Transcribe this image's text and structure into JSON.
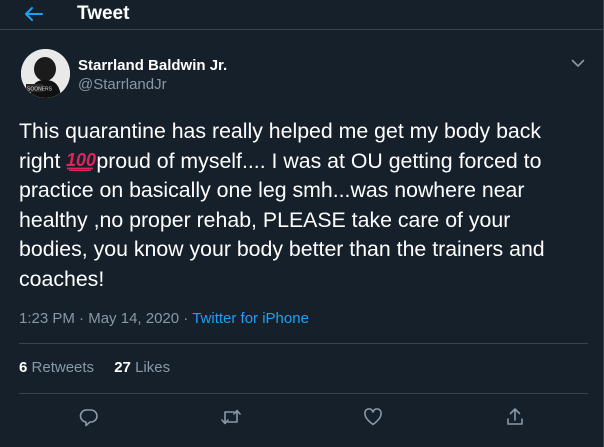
{
  "header": {
    "title": "Tweet",
    "back_icon": "arrow-left-icon"
  },
  "author": {
    "name": "Starrland Baldwin Jr.",
    "handle": "@StarrlandJr",
    "avatar_badge_text": "SOONERS"
  },
  "tweet": {
    "lines": [
      "This quarantine has really helped me get my body back",
      "proud of myself.... I was at OU getting forced to",
      "practice on basically one leg smh...was nowhere near",
      "healthy ,no proper rehab, PLEASE take care of your",
      "bodies, you know your body better than the trainers and",
      "coaches!"
    ],
    "line2_prefix": "right",
    "emoji": "100-emoji"
  },
  "meta": {
    "time": "1:23 PM",
    "separator": "·",
    "date": "May 14, 2020",
    "source": "Twitter for iPhone"
  },
  "stats": {
    "retweets_count": "6",
    "retweets_label": "Retweets",
    "likes_count": "27",
    "likes_label": "Likes"
  },
  "actions": [
    "reply-icon",
    "retweet-icon",
    "like-icon",
    "share-icon"
  ],
  "colors": {
    "background": "#15202b",
    "border": "#38444d",
    "secondary_text": "#8899a6",
    "accent": "#1da1f2"
  }
}
